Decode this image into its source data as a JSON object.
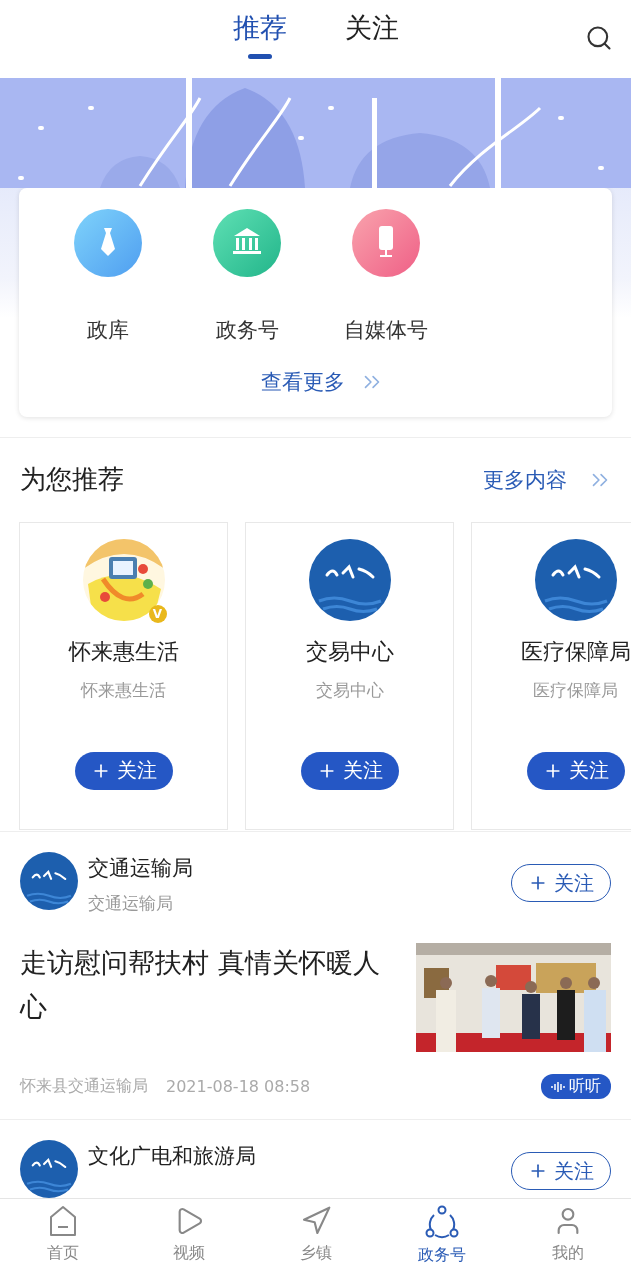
{
  "header": {
    "tabs": [
      {
        "label": "推荐",
        "selected": true
      },
      {
        "label": "关注",
        "selected": false
      }
    ]
  },
  "categories": {
    "items": [
      {
        "label": "政库",
        "kind": "tie"
      },
      {
        "label": "政务号",
        "kind": "bank"
      },
      {
        "label": "自媒体号",
        "kind": "mic"
      }
    ],
    "more": "查看更多"
  },
  "recommend": {
    "title": "为您推荐",
    "more": "更多内容",
    "accounts": [
      {
        "name": "怀来惠生活",
        "subtitle": "怀来惠生活",
        "kind": "illustration",
        "badge": "V",
        "follow": "关注"
      },
      {
        "name": "交易中心",
        "subtitle": "交易中心",
        "kind": "logo",
        "follow": "关注"
      },
      {
        "name": "医疗保障局",
        "subtitle": "医疗保障局",
        "kind": "logo",
        "follow": "关注"
      }
    ]
  },
  "posts": [
    {
      "author": "交通运输局",
      "subtitle": "交通运输局",
      "follow": "关注",
      "title": "走访慰问帮扶村 真情关怀暖人心",
      "source": "怀来县交通运输局",
      "time": "2021-08-18 08:58",
      "listen": "听听"
    },
    {
      "author": "文化广电和旅游局",
      "follow": "关注"
    }
  ],
  "nav": [
    {
      "label": "首页",
      "kind": "home",
      "selected": false
    },
    {
      "label": "视频",
      "kind": "video",
      "selected": false
    },
    {
      "label": "乡镇",
      "kind": "town",
      "selected": false
    },
    {
      "label": "政务号",
      "kind": "gov",
      "selected": true
    },
    {
      "label": "我的",
      "kind": "me",
      "selected": false
    }
  ]
}
